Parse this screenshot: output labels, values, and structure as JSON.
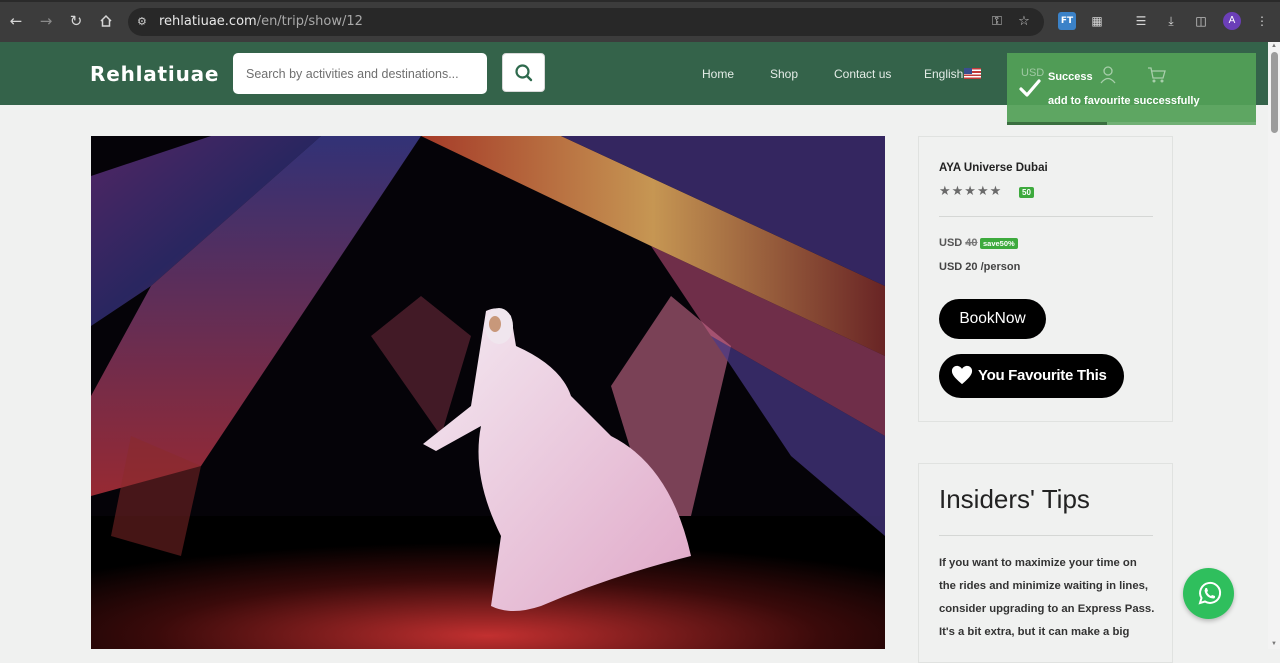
{
  "browser": {
    "url_host": "rehlatiuae.com",
    "url_path": "/en/trip/show/12",
    "profile_initial": "A",
    "extension_label": "FT"
  },
  "header": {
    "logo": "Rehlatiuae",
    "search_placeholder": "Search by activities and destinations...",
    "nav": [
      "Home",
      "Shop",
      "Contact us",
      "English"
    ],
    "currency": "USD"
  },
  "trip": {
    "title": "AYA Universe Dubai",
    "stars": 5,
    "rating_badge": "50",
    "currency": "USD",
    "old_price": "40",
    "save_badge": "save50%",
    "new_price_line": "USD 20 /person",
    "book_label": "BookNow",
    "favourite_label": "You Favourite This"
  },
  "tips": {
    "title": "Insiders' Tips",
    "text": "If you want to maximize your time on the rides and minimize waiting in lines, consider upgrading to an Express Pass. It's a bit extra, but it can make a big"
  },
  "toast": {
    "title": "Success",
    "message": "add to favourite successfully",
    "progress": 0.4
  },
  "colors": {
    "header_bg": "#34634a",
    "toast_bg": "#53a057",
    "badge_green": "#3daa3d",
    "whatsapp_green": "#2fbf5d"
  },
  "icons": [
    "back-icon",
    "forward-icon",
    "reload-icon",
    "home-icon",
    "search-icon",
    "user-icon",
    "cart-icon",
    "heart-icon",
    "check-icon",
    "whatsapp-icon"
  ]
}
